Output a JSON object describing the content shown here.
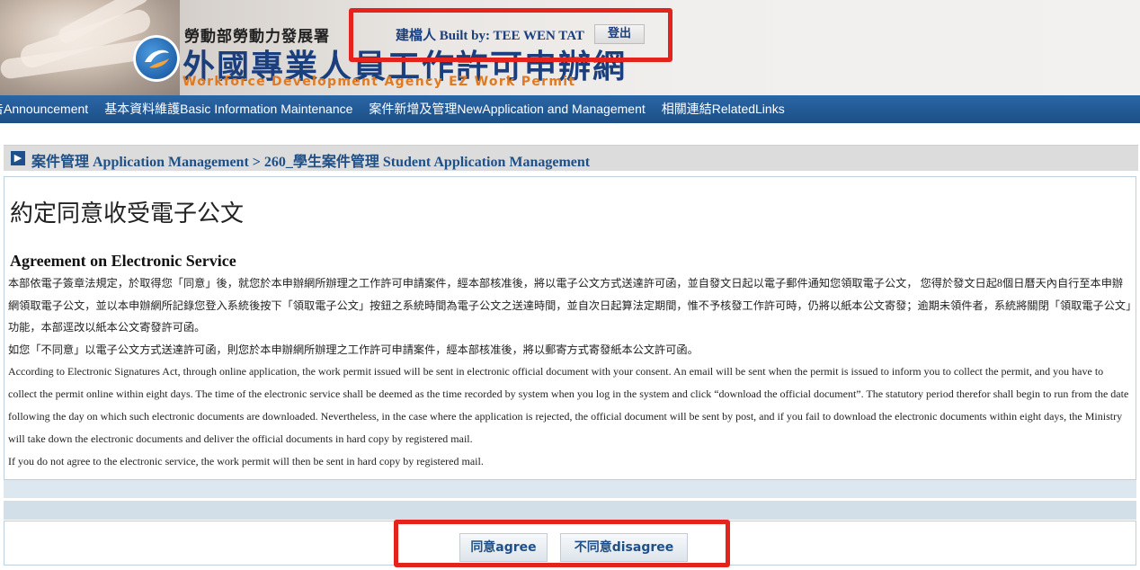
{
  "header": {
    "agency_cn": "勞動部勞動力發展署",
    "site_title": "外國專業人員工作許可申辦網",
    "site_subtitle": "Workforce Development Agency EZ Work Permit",
    "built_by": "建檔人 Built by: TEE WEN TAT",
    "logout_label": "登出"
  },
  "nav": {
    "items": [
      "告Announcement",
      "基本資料維護Basic Information Maintenance",
      "案件新增及管理NewApplication and Management",
      "相關連結RelatedLinks"
    ]
  },
  "breadcrumb": {
    "icon": "chevron-right-icon",
    "text": "案件管理 Application Management > 260_學生案件管理 Student Application Management"
  },
  "main": {
    "title": "約定同意收受電子公文",
    "heading": "Agreement on Electronic Service",
    "paragraphs_cn": [
      "本部依電子簽章法規定，於取得您「同意」後，就您於本申辦網所辦理之工作許可申請案件，經本部核准後，將以電子公文方式送達許可函，並自發文日起以電子郵件通知您領取電子公文， 您得於發文日起8個日曆天內自行至本申辦網領取電子公文，並以本申辦網所記錄您登入系統後按下「領取電子公文」按鈕之系統時間為電子公文之送達時間，並自次日起算法定期間，惟不予核發工作許可時，仍將以紙本公文寄發；逾期未領件者，系統將關閉「領取電子公文」功能，本部逕改以紙本公文寄發許可函。",
      "如您「不同意」以電子公文方式送達許可函，則您於本申辦網所辦理之工作許可申請案件，經本部核准後，將以郵寄方式寄發紙本公文許可函。"
    ],
    "paragraphs_en": [
      "According to Electronic Signatures Act, through online application, the work permit issued will be sent in electronic official document with your consent. An email will be sent when the permit is issued to inform you to collect the permit, and you have to collect the permit online within eight days. The time of the electronic service shall be deemed as the time recorded by system when you log in the system and click “download the official document”. The statutory period therefor shall begin to run from the date following the day on which such electronic documents are downloaded. Nevertheless, in the case where the application is rejected, the official document will be sent by post, and if you fail to download the electronic documents within eight days, the Ministry will take down the electronic documents and deliver the official documents in hard copy by registered mail.",
      "If you do not agree to the electronic service, the work permit will then be sent in hard copy by registered mail."
    ]
  },
  "actions": {
    "agree_label": "同意agree",
    "disagree_label": "不同意disagree"
  },
  "colors": {
    "nav_blue": "#1c4f86",
    "title_blue": "#1b3f7d",
    "subtitle_orange": "#e07a22",
    "highlight_red": "#e3231c"
  }
}
